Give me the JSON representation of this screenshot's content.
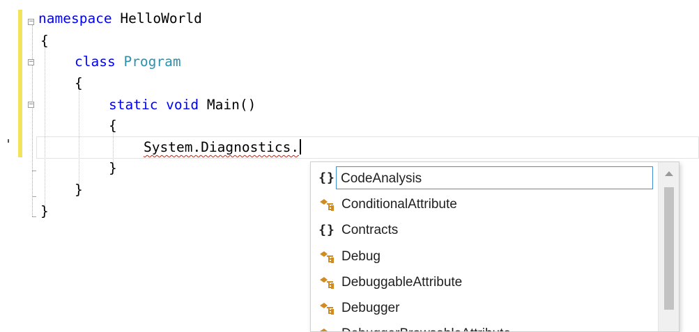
{
  "editor": {
    "lines": [
      {
        "keyword": "namespace",
        "text": " HelloWorld"
      },
      {
        "text": "{"
      },
      {
        "keyword": "class",
        "type": "Program"
      },
      {
        "text": "{"
      },
      {
        "keyword": "static void",
        "text": " Main()"
      },
      {
        "text": "{"
      },
      {
        "text": "System.Diagnostics."
      },
      {
        "text": "}"
      },
      {
        "text": "}"
      },
      {
        "text": "}"
      }
    ]
  },
  "completion": {
    "items": [
      {
        "label": "CodeAnalysis",
        "kind": "namespace",
        "icon": "namespace-icon",
        "selected": true
      },
      {
        "label": "ConditionalAttribute",
        "kind": "class",
        "icon": "class-icon"
      },
      {
        "label": "Contracts",
        "kind": "namespace",
        "icon": "namespace-icon"
      },
      {
        "label": "Debug",
        "kind": "class",
        "icon": "class-icon"
      },
      {
        "label": "DebuggableAttribute",
        "kind": "class",
        "icon": "class-icon"
      },
      {
        "label": "Debugger",
        "kind": "class",
        "icon": "class-icon"
      },
      {
        "label": "DebuggerBrowsableAttribute",
        "kind": "class",
        "icon": "class-icon"
      }
    ],
    "colors": {
      "selection_border": "#3d8fd6",
      "class_icon": "#d18b1f"
    }
  },
  "colors": {
    "keyword": "#0000ff",
    "type": "#2b91af",
    "change_bar": "#f1e45c",
    "squiggle": "#e51400"
  }
}
